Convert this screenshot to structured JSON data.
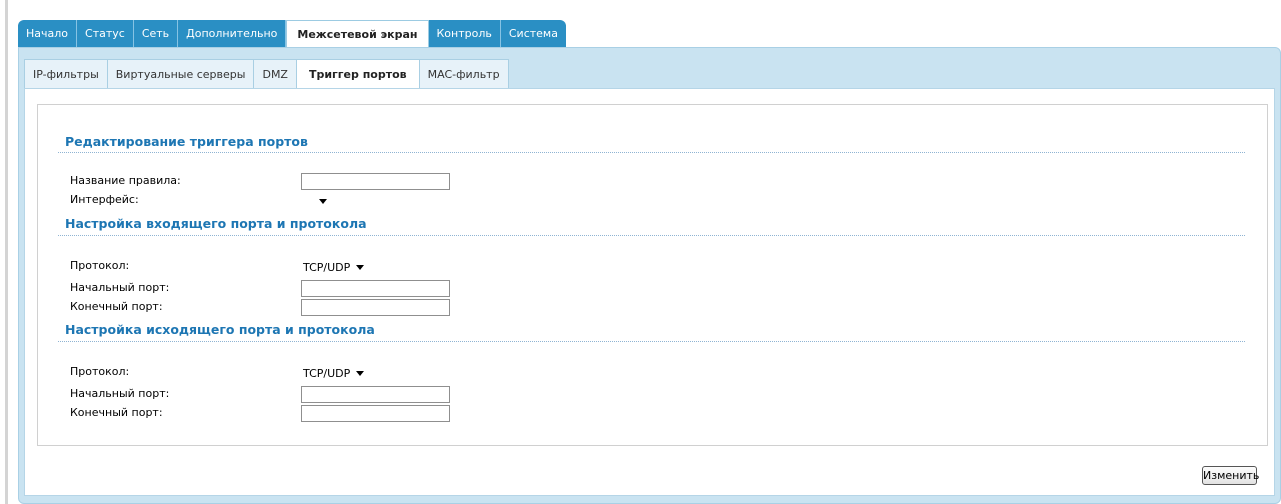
{
  "main_tabs": [
    "Начало",
    "Статус",
    "Сеть",
    "Дополнительно",
    "Межсетевой экран",
    "Контроль",
    "Система"
  ],
  "main_active": "Межсетевой экран",
  "sub_tabs": [
    "IP-фильтры",
    "Виртуальные серверы",
    "DMZ",
    "Триггер портов",
    "MAC-фильтр"
  ],
  "sub_active": "Триггер портов",
  "section_edit": {
    "title": "Редактирование триггера портов",
    "rule_name_label": "Название правила:",
    "rule_name_value": "",
    "interface_label": "Интерфейс:",
    "interface_value": ""
  },
  "section_incoming": {
    "title": "Настройка входящего порта и протокола",
    "protocol_label": "Протокол:",
    "protocol_value": "TCP/UDP",
    "start_port_label": "Начальный порт:",
    "start_port_value": "",
    "end_port_label": "Конечный порт:",
    "end_port_value": ""
  },
  "section_outgoing": {
    "title": "Настройка исходящего порта и протокола",
    "protocol_label": "Протокол:",
    "protocol_value": "TCP/UDP",
    "start_port_label": "Начальный порт:",
    "start_port_value": "",
    "end_port_label": "Конечный порт:",
    "end_port_value": ""
  },
  "change_button": "Изменить"
}
